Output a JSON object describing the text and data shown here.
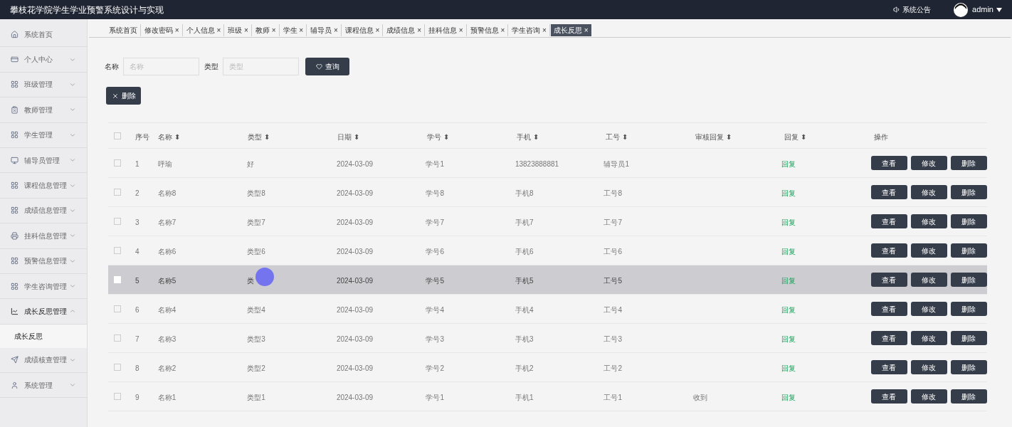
{
  "header": {
    "title": "攀枝花学院学生学业预警系统设计与实现",
    "notice": "系统公告",
    "user": "admin"
  },
  "sidebar": {
    "items": [
      {
        "label": "系统首页",
        "expandable": false,
        "expanded": false
      },
      {
        "label": "个人中心",
        "expandable": true,
        "expanded": false
      },
      {
        "label": "班级管理",
        "expandable": true,
        "expanded": false
      },
      {
        "label": "教师管理",
        "expandable": true,
        "expanded": false
      },
      {
        "label": "学生管理",
        "expandable": true,
        "expanded": false
      },
      {
        "label": "辅导员管理",
        "expandable": true,
        "expanded": false
      },
      {
        "label": "课程信息管理",
        "expandable": true,
        "expanded": false
      },
      {
        "label": "成绩信息管理",
        "expandable": true,
        "expanded": false
      },
      {
        "label": "挂科信息管理",
        "expandable": true,
        "expanded": false
      },
      {
        "label": "预警信息管理",
        "expandable": true,
        "expanded": false
      },
      {
        "label": "学生咨询管理",
        "expandable": true,
        "expanded": false
      },
      {
        "label": "成长反思管理",
        "expandable": true,
        "expanded": true,
        "children": [
          {
            "label": "成长反思"
          }
        ]
      },
      {
        "label": "成绩核查管理",
        "expandable": true,
        "expanded": false
      },
      {
        "label": "系统管理",
        "expandable": true,
        "expanded": false
      }
    ]
  },
  "tabs": [
    {
      "label": "系统首页",
      "selected": false
    },
    {
      "label": "修改密码 ×",
      "selected": false
    },
    {
      "label": "个人信息 ×",
      "selected": false
    },
    {
      "label": "班级 ×",
      "selected": false
    },
    {
      "label": "教师 ×",
      "selected": false
    },
    {
      "label": "学生 ×",
      "selected": false
    },
    {
      "label": "辅导员 ×",
      "selected": false
    },
    {
      "label": "课程信息 ×",
      "selected": false
    },
    {
      "label": "成绩信息 ×",
      "selected": false
    },
    {
      "label": "挂科信息 ×",
      "selected": false
    },
    {
      "label": "预警信息 ×",
      "selected": false
    },
    {
      "label": "学生咨询 ×",
      "selected": false
    },
    {
      "label": "成长反思 ×",
      "selected": true
    }
  ],
  "search": {
    "fields": [
      {
        "label": "名称",
        "placeholder": "名称"
      },
      {
        "label": "类型",
        "placeholder": "类型"
      }
    ],
    "button": "查询"
  },
  "delete_button": "删除",
  "table": {
    "select_all": {
      "checked": false
    },
    "columns": [
      "序号",
      "名称 ⬍",
      "类型 ⬍",
      "日期 ⬍",
      "学号 ⬍",
      "手机 ⬍",
      "工号 ⬍",
      "审核回复 ⬍",
      "回复 ⬍",
      "操作"
    ],
    "rows": [
      {
        "selected": false,
        "cells": [
          "1",
          "呼瑜",
          "好",
          "2024-03-09",
          "学号1",
          "13823888881",
          "辅导员1"
        ],
        "reply": "回复",
        "actions": [
          "查看",
          "修改",
          "删除"
        ]
      },
      {
        "selected": false,
        "cells": [
          "2",
          "名称8",
          "类型8",
          "2024-03-09",
          "学号8",
          "手机8",
          "工号8"
        ],
        "reply": "回复",
        "actions": [
          "查看",
          "修改",
          "删除"
        ]
      },
      {
        "selected": false,
        "cells": [
          "3",
          "名称7",
          "类型7",
          "2024-03-09",
          "学号7",
          "手机7",
          "工号7"
        ],
        "reply": "回复",
        "actions": [
          "查看",
          "修改",
          "删除"
        ]
      },
      {
        "selected": false,
        "cells": [
          "4",
          "名称6",
          "类型6",
          "2024-03-09",
          "学号6",
          "手机6",
          "工号6"
        ],
        "reply": "回复",
        "actions": [
          "查看",
          "修改",
          "删除"
        ]
      },
      {
        "selected": true,
        "cells": [
          "5",
          "名称5",
          "类",
          "2024-03-09",
          "学号5",
          "手机5",
          "工号5"
        ],
        "reply": "回复",
        "actions": [
          "查看",
          "修改",
          "删除"
        ]
      },
      {
        "selected": false,
        "cells": [
          "6",
          "名称4",
          "类型4",
          "2024-03-09",
          "学号4",
          "手机4",
          "工号4"
        ],
        "reply": "回复",
        "actions": [
          "查看",
          "修改",
          "删除"
        ]
      },
      {
        "selected": false,
        "cells": [
          "7",
          "名称3",
          "类型3",
          "2024-03-09",
          "学号3",
          "手机3",
          "工号3"
        ],
        "reply": "回复",
        "actions": [
          "查看",
          "修改",
          "删除"
        ]
      },
      {
        "selected": false,
        "cells": [
          "8",
          "名称2",
          "类型2",
          "2024-03-09",
          "学号2",
          "手机2",
          "工号2"
        ],
        "reply": "回复",
        "actions": [
          "查看",
          "修改",
          "删除"
        ]
      },
      {
        "selected": false,
        "cells": [
          "9",
          "名称1",
          "类型1",
          "2024-03-09",
          "学号1",
          "手机1",
          "工号1"
        ],
        "audit_reply": "收到",
        "reply": "回复",
        "actions": [
          "查看",
          "修改",
          "删除"
        ]
      }
    ]
  }
}
